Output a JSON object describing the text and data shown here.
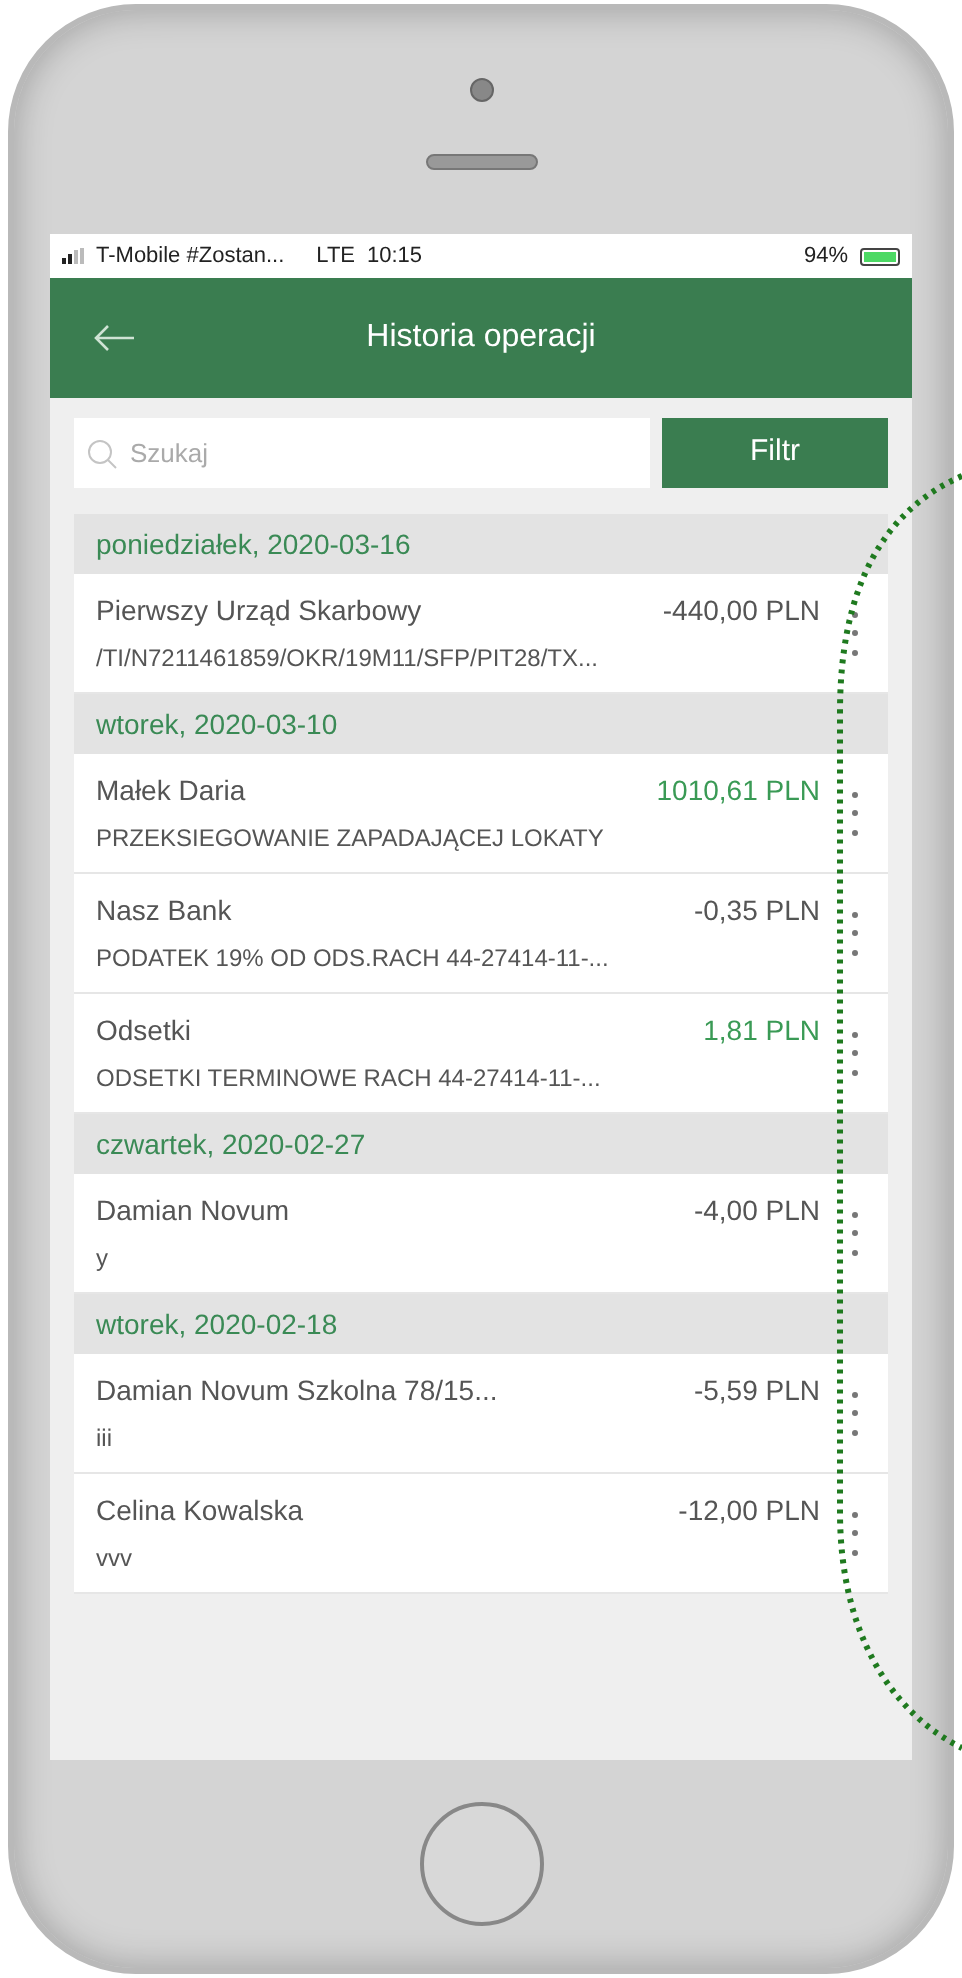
{
  "status_bar": {
    "carrier": "T-Mobile #Zostan...",
    "network": "LTE",
    "time": "10:15",
    "battery": "94%"
  },
  "header": {
    "title": "Historia operacji"
  },
  "search": {
    "placeholder": "Szukaj"
  },
  "filter_button": "Filtr",
  "groups": [
    {
      "date": "poniedziałek, 2020-03-16",
      "items": [
        {
          "name": "Pierwszy Urząd Skarbowy",
          "description": "/TI/N7211461859/OKR/19M11/SFP/PIT28/TX...",
          "amount": "-440,00 PLN",
          "kind": "expense"
        }
      ]
    },
    {
      "date": "wtorek, 2020-03-10",
      "items": [
        {
          "name": "Małek Daria",
          "description": "PRZEKSIEGOWANIE ZAPADAJĄCEJ LOKATY",
          "amount": "1010,61 PLN",
          "kind": "income"
        },
        {
          "name": "Nasz Bank",
          "description": "PODATEK 19% OD ODS.RACH 44-27414-11-...",
          "amount": "-0,35 PLN",
          "kind": "expense"
        },
        {
          "name": "Odsetki",
          "description": "ODSETKI TERMINOWE RACH 44-27414-11-...",
          "amount": "1,81 PLN",
          "kind": "income"
        }
      ]
    },
    {
      "date": "czwartek, 2020-02-27",
      "items": [
        {
          "name": "Damian Novum",
          "description": "y",
          "amount": "-4,00 PLN",
          "kind": "expense"
        }
      ]
    },
    {
      "date": "wtorek, 2020-02-18",
      "items": [
        {
          "name": "Damian Novum Szkolna 78/15...",
          "description": "iii",
          "amount": "-5,59 PLN",
          "kind": "expense"
        },
        {
          "name": "Celina Kowalska",
          "description": "vvv",
          "amount": "-12,00 PLN",
          "kind": "expense"
        }
      ]
    }
  ]
}
